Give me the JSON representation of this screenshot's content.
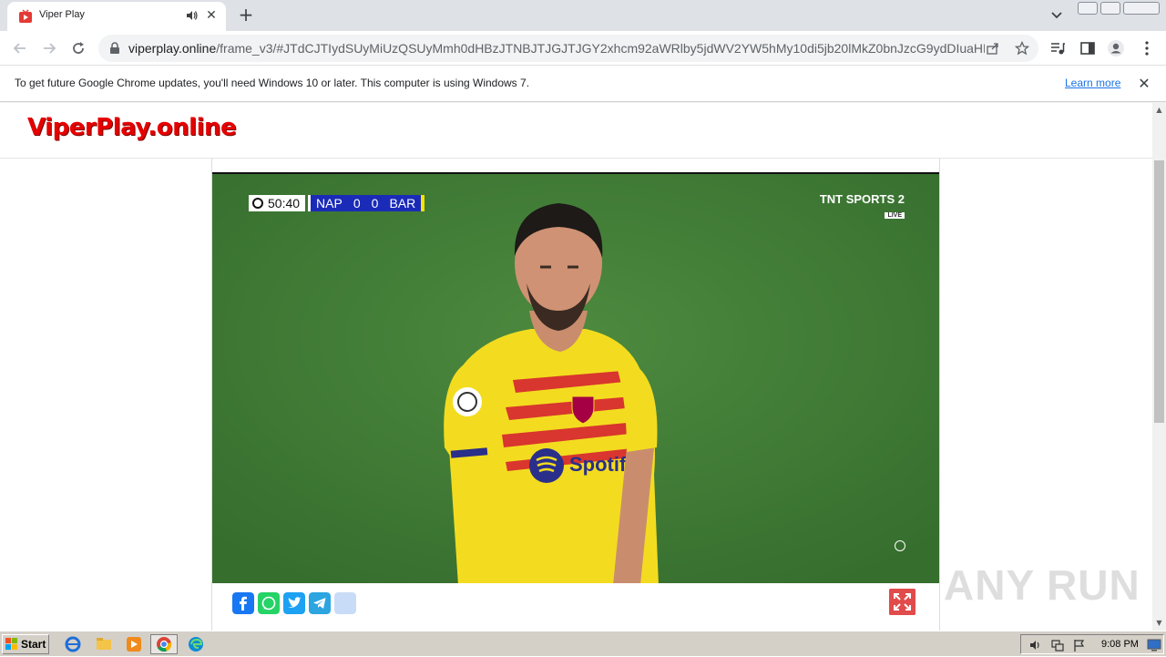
{
  "browser": {
    "tab": {
      "title": "Viper Play"
    },
    "url": {
      "host": "viperplay.online",
      "path": "/frame_v3/#JTdCJTIydSUyMiUzQSUyMmh0dHBzJTNBJTJGJTJGY2xhcm92aWRlby5jdWV2YW5hMy10di5jb20lMkZ0bnJzcG9ydDIuaHR..."
    },
    "infobar": {
      "message": "To get future Google Chrome updates, you'll need Windows 10 or later. This computer is using Windows 7.",
      "link": "Learn more"
    }
  },
  "site": {
    "logo": "ViperPlay.online"
  },
  "video": {
    "clock": "50:40",
    "home_team": "NAP",
    "home_score": "0",
    "away_score": "0",
    "away_team": "BAR",
    "channel": "TNT SPORTS 2",
    "live_badge": "LIVE"
  },
  "share": [
    "facebook-icon",
    "whatsapp-icon",
    "twitter-icon",
    "telegram-icon",
    "share-icon"
  ],
  "colors": {
    "logo": "#e60000",
    "scorebug_blue": "#1a2bb8",
    "scorebug_yellow": "#f5e400",
    "fullscreen": "#e24b4b",
    "facebook": "#1877f2",
    "whatsapp": "#25d366",
    "twitter": "#1da1f2",
    "telegram": "#2ca5e0"
  },
  "watermark": "ANY RUN",
  "taskbar": {
    "start": "Start",
    "clock": "9:08 PM"
  }
}
